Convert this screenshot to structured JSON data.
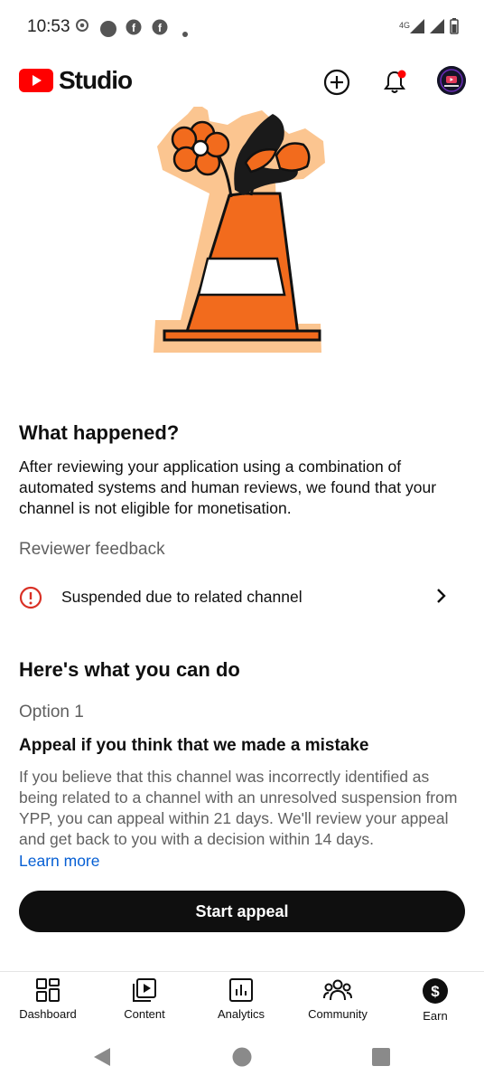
{
  "status_bar": {
    "time": "10:53",
    "network": "4G"
  },
  "app_bar": {
    "logo_text": "Studio",
    "brand_color": "#ff0000"
  },
  "what_happened": {
    "title": "What happened?",
    "description": "After reviewing your application using a combination of automated systems and human reviews, we found that your channel is not eligible for monetisation."
  },
  "reviewer_feedback": {
    "label": "Reviewer feedback",
    "item": "Suspended due to related channel"
  },
  "actions": {
    "title": "Here's what you can do",
    "option_label": "Option 1",
    "option_title": "Appeal if you think that we made a mistake",
    "option_description": "If you believe that this channel was incorrectly identified as being related to a channel with an unresolved suspension from YPP, you can appeal within 21 days. We'll review your appeal and get back to you with a decision within 14 days.",
    "learn_more": "Learn more",
    "button": "Start appeal"
  },
  "bottom_nav": {
    "items": [
      {
        "label": "Dashboard",
        "icon": "dashboard-icon"
      },
      {
        "label": "Content",
        "icon": "content-icon"
      },
      {
        "label": "Analytics",
        "icon": "analytics-icon"
      },
      {
        "label": "Community",
        "icon": "community-icon"
      },
      {
        "label": "Earn",
        "icon": "earn-icon"
      }
    ]
  },
  "colors": {
    "error": "#d93025",
    "link": "#065fd4",
    "cone_orange": "#f26b1d",
    "cone_outline": "#fbc590"
  }
}
